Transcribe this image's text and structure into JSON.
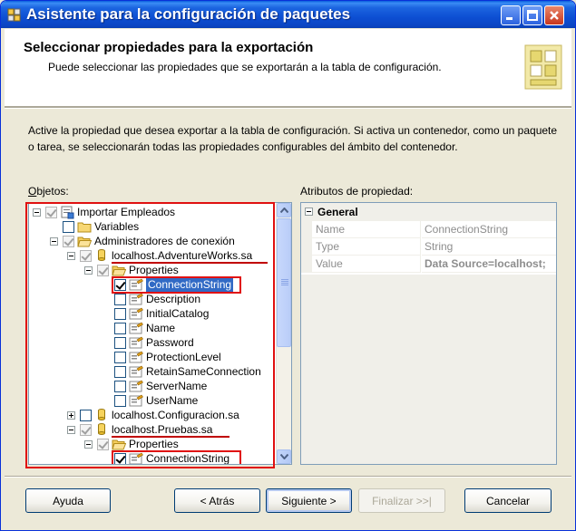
{
  "window": {
    "title": "Asistente para la configuración de paquetes"
  },
  "header": {
    "title": "Seleccionar propiedades para la exportación",
    "subtitle": "Puede seleccionar las propiedades que se exportarán a la tabla de configuración."
  },
  "intro": "Active la propiedad que desea exportar a la tabla de configuración. Si activa un contenedor, como un paquete o tarea, se seleccionarán todas las propiedades configurables del ámbito del contenedor.",
  "objects_label": "Objetos:",
  "objects_label_mnemonic": "O",
  "objects_label_rest": "bjetos:",
  "attributes_label": "Atributos de propiedad:",
  "tree": [
    {
      "label": "Importar Empleados",
      "checked": true,
      "gray": true,
      "icon": "package-icon",
      "expander": "minus"
    },
    {
      "label": "Variables",
      "checked": false,
      "gray": false,
      "icon": "folder-icon",
      "expander": null
    },
    {
      "label": "Administradores de conexión",
      "checked": true,
      "gray": true,
      "icon": "folder-open-icon",
      "expander": "minus"
    },
    {
      "label": "localhost.AdventureWorks.sa",
      "checked": true,
      "gray": true,
      "icon": "connection-icon",
      "expander": "minus"
    },
    {
      "label": "Properties",
      "checked": true,
      "gray": true,
      "icon": "folder-open-icon",
      "expander": "minus"
    },
    {
      "label": "ConnectionString",
      "checked": true,
      "gray": false,
      "icon": "property-icon",
      "expander": null,
      "selected": true
    },
    {
      "label": "Description",
      "checked": false,
      "gray": false,
      "icon": "property-icon",
      "expander": null
    },
    {
      "label": "InitialCatalog",
      "checked": false,
      "gray": false,
      "icon": "property-icon",
      "expander": null
    },
    {
      "label": "Name",
      "checked": false,
      "gray": false,
      "icon": "property-icon",
      "expander": null
    },
    {
      "label": "Password",
      "checked": false,
      "gray": false,
      "icon": "property-icon",
      "expander": null
    },
    {
      "label": "ProtectionLevel",
      "checked": false,
      "gray": false,
      "icon": "property-icon",
      "expander": null
    },
    {
      "label": "RetainSameConnection",
      "checked": false,
      "gray": false,
      "icon": "property-icon",
      "expander": null
    },
    {
      "label": "ServerName",
      "checked": false,
      "gray": false,
      "icon": "property-icon",
      "expander": null
    },
    {
      "label": "UserName",
      "checked": false,
      "gray": false,
      "icon": "property-icon",
      "expander": null
    },
    {
      "label": "localhost.Configuracion.sa",
      "checked": false,
      "gray": false,
      "icon": "connection-icon",
      "expander": "plus"
    },
    {
      "label": "localhost.Pruebas.sa",
      "checked": true,
      "gray": true,
      "icon": "connection-icon",
      "expander": "minus"
    },
    {
      "label": "Properties",
      "checked": true,
      "gray": true,
      "icon": "folder-open-icon",
      "expander": "minus"
    },
    {
      "label": "ConnectionString",
      "checked": true,
      "gray": false,
      "icon": "property-icon",
      "expander": null
    }
  ],
  "property_grid": {
    "category": "General",
    "rows": [
      {
        "name": "Name",
        "value": "ConnectionString"
      },
      {
        "name": "Type",
        "value": "String"
      },
      {
        "name": "Value",
        "value": "Data Source=localhost;"
      }
    ]
  },
  "buttons": {
    "help": "Ayuda",
    "help_mnemonic": "y",
    "back": "< Atrás",
    "next": "Siguiente >",
    "finish": "Finalizar >>|",
    "cancel": "Cancelar"
  },
  "colors": {
    "selection": "#316ac5",
    "highlight_red": "#e01010",
    "titlebar": "#0b46c4"
  }
}
